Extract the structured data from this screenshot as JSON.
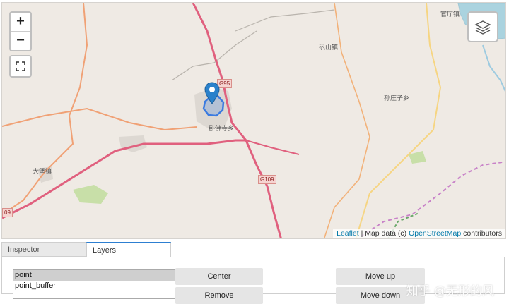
{
  "map": {
    "zoom_in_label": "+",
    "zoom_out_label": "−",
    "attribution": {
      "leaflet": "Leaflet",
      "separator": " | Map data (c) ",
      "osm": "OpenStreetMap",
      "contributors": " contributors"
    },
    "labels": {
      "guantingzhen": "官厅镇",
      "fanshanzhen": "矾山镇",
      "sunzhuangzixiang": "孙庄子乡",
      "wofosixiang": "卧佛寺乡",
      "dabaozhen": "大堡镇"
    },
    "shields": {
      "g95": "G95",
      "g109": "G109",
      "g109_left": "09"
    },
    "colors": {
      "background": "#efeae4",
      "motorway": "#e0607e",
      "trunk": "#f0a175",
      "secondary": "#f6d582",
      "boundary": "#c882c8",
      "buffer": "#3b7be0",
      "marker": "#2a81cb"
    }
  },
  "panel": {
    "tabs": [
      {
        "label": "Inspector",
        "active": false
      },
      {
        "label": "Layers",
        "active": true
      }
    ],
    "layers": [
      {
        "name": "point",
        "selected": true
      },
      {
        "name": "point_buffer",
        "selected": false
      }
    ],
    "buttons": {
      "center": "Center",
      "remove": "Remove",
      "move_up": "Move up",
      "move_down": "Move down"
    }
  },
  "watermark": "知乎 @无形的风"
}
